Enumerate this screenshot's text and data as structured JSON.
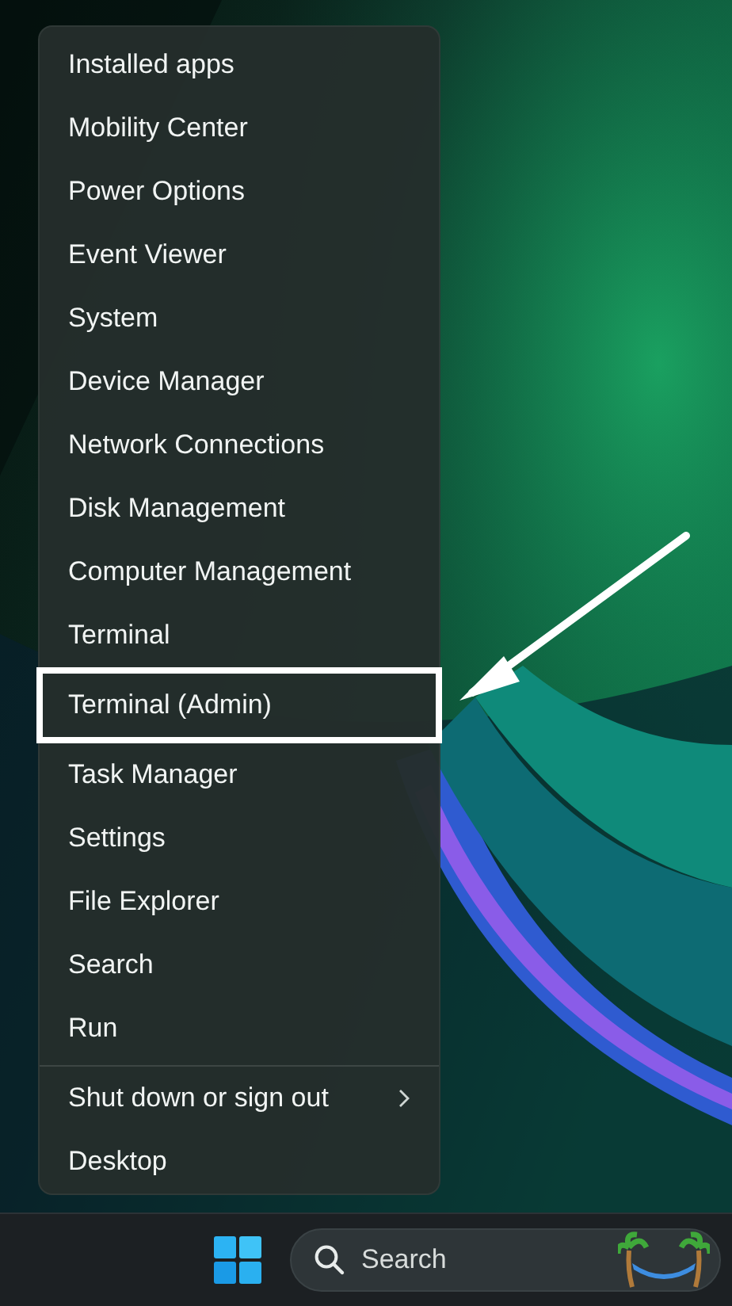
{
  "menu": {
    "groups": [
      {
        "items": [
          {
            "label": "Installed apps",
            "highlighted": false,
            "submenu": false
          },
          {
            "label": "Mobility Center",
            "highlighted": false,
            "submenu": false
          },
          {
            "label": "Power Options",
            "highlighted": false,
            "submenu": false
          },
          {
            "label": "Event Viewer",
            "highlighted": false,
            "submenu": false
          },
          {
            "label": "System",
            "highlighted": false,
            "submenu": false
          },
          {
            "label": "Device Manager",
            "highlighted": false,
            "submenu": false
          },
          {
            "label": "Network Connections",
            "highlighted": false,
            "submenu": false
          },
          {
            "label": "Disk Management",
            "highlighted": false,
            "submenu": false
          },
          {
            "label": "Computer Management",
            "highlighted": false,
            "submenu": false
          },
          {
            "label": "Terminal",
            "highlighted": false,
            "submenu": false
          },
          {
            "label": "Terminal (Admin)",
            "highlighted": true,
            "submenu": false
          },
          {
            "label": "Task Manager",
            "highlighted": false,
            "submenu": false
          },
          {
            "label": "Settings",
            "highlighted": false,
            "submenu": false
          },
          {
            "label": "File Explorer",
            "highlighted": false,
            "submenu": false
          },
          {
            "label": "Search",
            "highlighted": false,
            "submenu": false
          },
          {
            "label": "Run",
            "highlighted": false,
            "submenu": false
          }
        ]
      },
      {
        "items": [
          {
            "label": "Shut down or sign out",
            "highlighted": false,
            "submenu": true
          },
          {
            "label": "Desktop",
            "highlighted": false,
            "submenu": false
          }
        ]
      }
    ]
  },
  "taskbar": {
    "search": {
      "placeholder": "Search"
    }
  }
}
